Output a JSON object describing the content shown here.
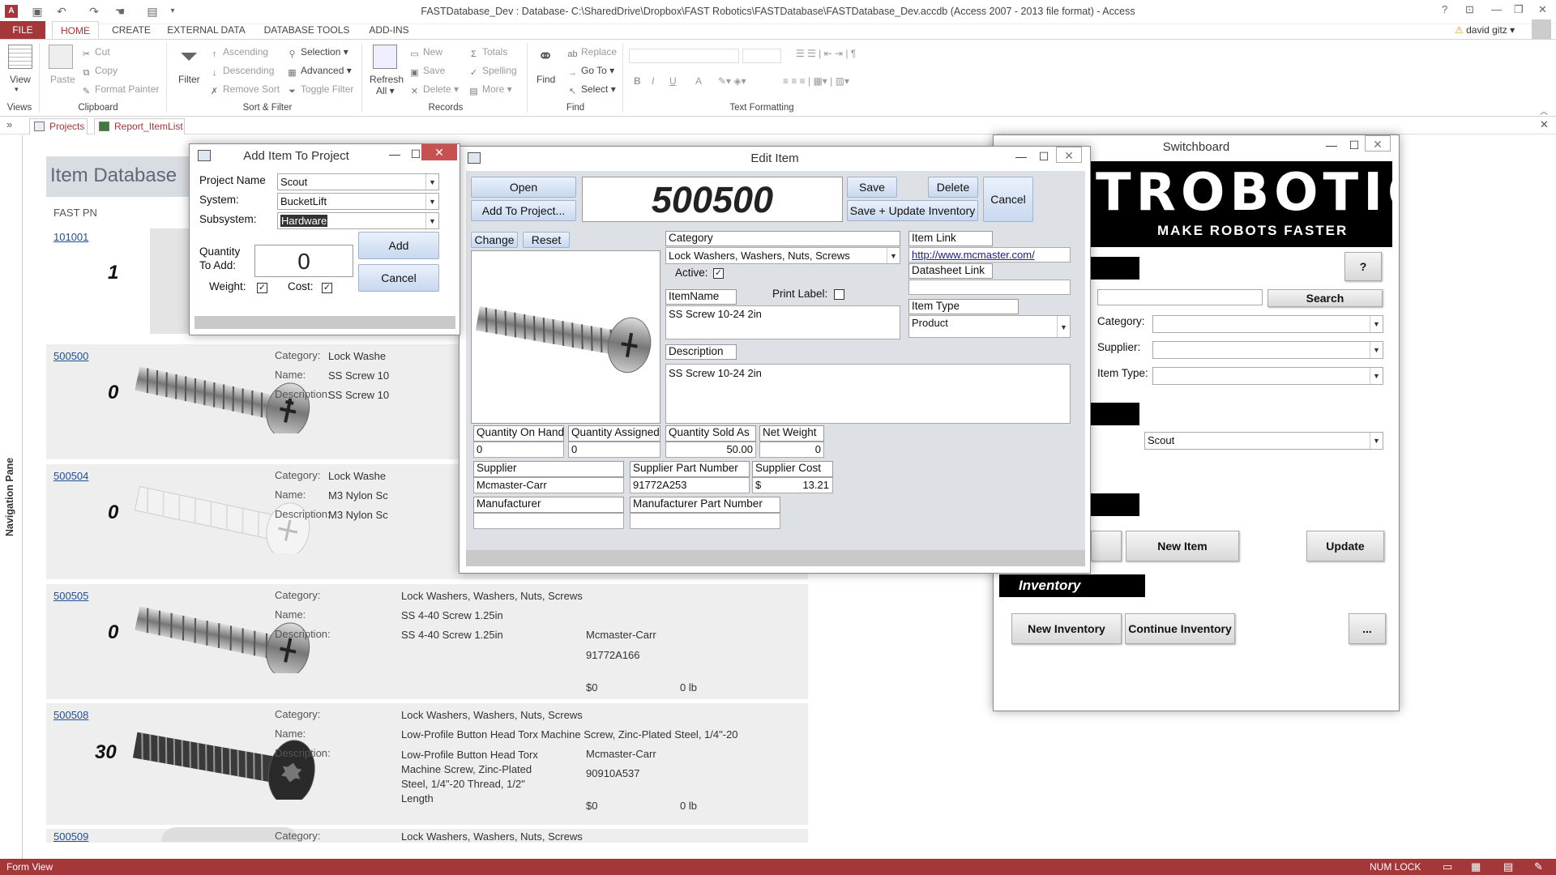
{
  "titlebar": {
    "title": "FASTDatabase_Dev : Database- C:\\SharedDrive\\Dropbox\\FAST Robotics\\FASTDatabase\\FASTDatabase_Dev.accdb (Access 2007 - 2013 file format) - Access",
    "help": "?",
    "user": "david gitz"
  },
  "ribbon_tabs": [
    "FILE",
    "HOME",
    "CREATE",
    "EXTERNAL DATA",
    "DATABASE TOOLS",
    "ADD-INS"
  ],
  "ribbon": {
    "views": {
      "view": "View",
      "group": "Views"
    },
    "clipboard": {
      "paste": "Paste",
      "cut": "Cut",
      "copy": "Copy",
      "format_painter": "Format Painter",
      "group": "Clipboard"
    },
    "sort_filter": {
      "filter": "Filter",
      "ascending": "Ascending",
      "descending": "Descending",
      "remove_sort": "Remove Sort",
      "selection": "Selection",
      "advanced": "Advanced",
      "toggle_filter": "Toggle Filter",
      "group": "Sort & Filter"
    },
    "records": {
      "refresh": "Refresh",
      "refresh_all": "All",
      "new": "New",
      "save": "Save",
      "delete": "Delete",
      "totals": "Totals",
      "spelling": "Spelling",
      "more": "More",
      "group": "Records"
    },
    "find": {
      "find": "Find",
      "replace": "Replace",
      "go_to": "Go To",
      "select": "Select",
      "group": "Find"
    },
    "text_formatting": {
      "group": "Text Formatting",
      "bold": "B",
      "italic": "I",
      "underline": "U",
      "font_color": "A"
    }
  },
  "doc_tabs": [
    "Projects",
    "Report_ItemList"
  ],
  "nav_pane": "Navigation Pane",
  "report": {
    "title": "Item Database",
    "fast_pn_label": "FAST PN",
    "labels": {
      "category": "Category:",
      "name": "Name:",
      "description": "Description:"
    },
    "rows": [
      {
        "pn": "101001",
        "qty": "1"
      },
      {
        "pn": "500500",
        "qty": "0",
        "category": "Lock Washe",
        "name": "SS Screw 10",
        "description": "SS Screw 10"
      },
      {
        "pn": "500504",
        "qty": "0",
        "category": "Lock Washe",
        "name": "M3 Nylon Sc",
        "description": "M3 Nylon Sc"
      },
      {
        "pn": "500505",
        "qty": "0",
        "category": "Lock Washers, Washers, Nuts, Screws",
        "name": "SS 4-40 Screw 1.25in",
        "description": "SS 4-40 Screw 1.25in",
        "supplier": "Mcmaster-Carr",
        "supplier_pn": "91772A166",
        "cost": "$0",
        "weight": "0 lb"
      },
      {
        "pn": "500508",
        "qty": "30",
        "category": "Lock Washers, Washers, Nuts, Screws",
        "name": "Low-Profile Button Head Torx Machine Screw, Zinc-Plated Steel, 1/4\"-20",
        "description_lines": [
          "Low-Profile Button Head Torx",
          "Machine Screw, Zinc-Plated",
          "Steel, 1/4\"-20 Thread, 1/2\"",
          "Length"
        ],
        "supplier": "Mcmaster-Carr",
        "supplier_pn": "90910A537",
        "cost": "$0",
        "weight": "0 lb"
      },
      {
        "pn": "500509",
        "category": "Lock Washers, Washers, Nuts, Screws"
      }
    ]
  },
  "add_item": {
    "title": "Add Item To Project",
    "project_name_label": "Project Name",
    "project_name": "Scout",
    "system_label": "System:",
    "system": "BucketLift",
    "subsystem_label": "Subsystem:",
    "subsystem": "Hardware",
    "qty_label_1": "Quantity",
    "qty_label_2": "To Add:",
    "qty": "0",
    "add": "Add",
    "cancel": "Cancel",
    "weight_label": "Weight:",
    "cost_label": "Cost:"
  },
  "edit_item": {
    "title": "Edit Item",
    "open": "Open",
    "add_to_project": "Add To Project...",
    "item_number": "500500",
    "save": "Save",
    "delete": "Delete",
    "cancel": "Cancel",
    "save_update": "Save + Update Inventory",
    "change": "Change",
    "reset": "Reset",
    "category_label": "Category",
    "category": "Lock Washers, Washers, Nuts, Screws",
    "active_label": "Active:",
    "print_label": "Print Label:",
    "item_name_label": "ItemName",
    "item_name": "SS Screw 10-24 2in",
    "description_label": "Description",
    "description": "SS Screw 10-24 2in",
    "item_link_label": "Item Link",
    "item_link": "http://www.mcmaster.com/",
    "datasheet_label": "Datasheet Link",
    "item_type_label": "Item Type",
    "item_type": "Product",
    "qoh_label": "Quantity On Hand",
    "qoh": "0",
    "qassigned_label": "Quantity Assigned",
    "qassigned": "0",
    "qsold_label": "Quantity Sold As",
    "qsold": "50.00",
    "netw_label": "Net Weight",
    "netw": "0",
    "supplier_label": "Supplier",
    "supplier": "Mcmaster-Carr",
    "supplier_pn_label": "Supplier Part Number",
    "supplier_pn": "91772A253",
    "supplier_cost_label": "Supplier Cost",
    "supplier_cost_symbol": "$",
    "supplier_cost": "13.21",
    "manufacturer_label": "Manufacturer",
    "manufacturer_pn_label": "Manufacturer Part Number"
  },
  "switchboard": {
    "title": "Switchboard",
    "logo_main": "TROBOTICS",
    "logo_sub": "MAKE ROBOTS FASTER",
    "help": "?",
    "search": "Search",
    "category_label": "Category:",
    "supplier_label": "Supplier:",
    "item_type_label": "Item Type:",
    "project": "Scout",
    "new_item": "New Item",
    "update": "Update",
    "inventory_header": "Inventory",
    "new_inventory": "New Inventory",
    "continue_inventory": "Continue Inventory",
    "more": "..."
  },
  "status": {
    "left": "Form View",
    "num_lock": "NUM LOCK"
  },
  "colors": {
    "access_red": "#a4373a",
    "link_blue": "#1f4e9a",
    "form_gray": "#dde1e6"
  }
}
